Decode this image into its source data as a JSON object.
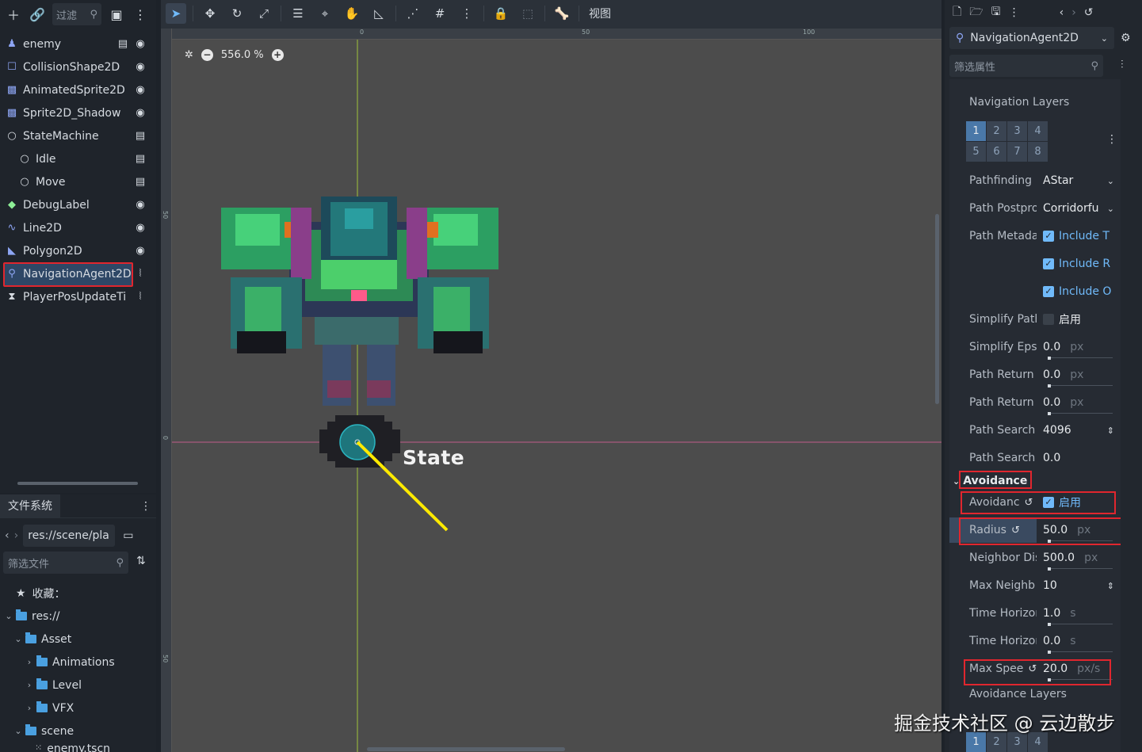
{
  "scene_panel": {
    "filter_placeholder": "过滤",
    "nodes": [
      {
        "name": "enemy",
        "icon": "character-body-icon",
        "right_icon": "script-icon",
        "second_icon": "visibility-icon"
      },
      {
        "name": "CollisionShape2D",
        "icon": "collision-shape-icon",
        "right_icon": "visibility-icon"
      },
      {
        "name": "AnimatedSprite2D",
        "icon": "animated-sprite-icon",
        "right_icon": "visibility-icon"
      },
      {
        "name": "Sprite2D_Shadow",
        "icon": "sprite-icon",
        "right_icon": "visibility-icon"
      },
      {
        "name": "StateMachine",
        "icon": "node-icon",
        "right_icon": "script-icon"
      },
      {
        "name": "Idle",
        "icon": "node-icon",
        "right_icon": "script-icon"
      },
      {
        "name": "Move",
        "icon": "node-icon",
        "right_icon": "script-icon"
      },
      {
        "name": "DebugLabel",
        "icon": "label-icon",
        "right_icon": "visibility-icon"
      },
      {
        "name": "Line2D",
        "icon": "line-icon",
        "right_icon": "visibility-icon"
      },
      {
        "name": "Polygon2D",
        "icon": "polygon-icon",
        "right_icon": "visibility-icon"
      },
      {
        "name": "NavigationAgent2D",
        "icon": "navigation-agent-icon",
        "right_icon": "signal-icon"
      },
      {
        "name": "PlayerPosUpdateTi",
        "icon": "timer-icon",
        "right_icon": "signal-icon"
      }
    ]
  },
  "filesystem": {
    "tab_label": "文件系统",
    "path": "res://scene/pla",
    "search_placeholder": "筛选文件",
    "items": [
      {
        "label": "收藏：",
        "type": "favorites"
      },
      {
        "label": "res://",
        "type": "root"
      },
      {
        "label": "Asset",
        "type": "folder"
      },
      {
        "label": "Animations",
        "type": "folder"
      },
      {
        "label": "Level",
        "type": "folder"
      },
      {
        "label": "VFX",
        "type": "folder"
      },
      {
        "label": "scene",
        "type": "folder"
      },
      {
        "label": "enemy.tscn",
        "type": "file"
      }
    ]
  },
  "viewport": {
    "view_menu": "视图",
    "zoom": "556.0 %",
    "ruler_top": [
      "0",
      "50",
      "100"
    ],
    "ruler_left": [
      "50",
      "0",
      "50"
    ],
    "debug_label": "State"
  },
  "inspector": {
    "node_name": "NavigationAgent2D",
    "filter_placeholder": "筛选属性",
    "nav_layers_label": "Navigation Layers",
    "layers": [
      "1",
      "2",
      "3",
      "4",
      "5",
      "6",
      "7",
      "8"
    ],
    "props": {
      "pathfinding": {
        "name": "Pathfinding",
        "value": "AStar"
      },
      "path_postpro": {
        "name": "Path Postpro",
        "value": "Corridorfu"
      },
      "path_metada": {
        "name": "Path Metada",
        "value": "Include T"
      },
      "include_r": {
        "value": "Include R"
      },
      "include_o": {
        "value": "Include O"
      },
      "simplify_path": {
        "name": "Simplify Path",
        "value": "启用"
      },
      "simplify_epsil": {
        "name": "Simplify Epsil",
        "value": "0.0",
        "unit": "px"
      },
      "path_return1": {
        "name": "Path Return",
        "value": "0.0",
        "unit": "px"
      },
      "path_return2": {
        "name": "Path Return",
        "value": "0.0",
        "unit": "px"
      },
      "path_search1": {
        "name": "Path Search",
        "value": "4096"
      },
      "path_search2": {
        "name": "Path Search",
        "value": "0.0"
      },
      "avoidance_section": "Avoidance",
      "avoidance": {
        "name": "Avoidanc",
        "value": "启用"
      },
      "radius": {
        "name": "Radius",
        "value": "50.0",
        "unit": "px"
      },
      "neighbor": {
        "name": "Neighbor Dis",
        "value": "500.0",
        "unit": "px"
      },
      "max_neigh": {
        "name": "Max Neighb",
        "value": "10"
      },
      "time_h1": {
        "name": "Time Horizon",
        "value": "1.0",
        "unit": "s"
      },
      "time_h2": {
        "name": "Time Horizon",
        "value": "0.0",
        "unit": "s"
      },
      "max_speed": {
        "name": "Max Spee",
        "value": "20.0",
        "unit": "px/s"
      },
      "avoid_layers": {
        "name": "Avoidance Layers"
      }
    }
  },
  "watermark": "掘金技术社区 @ 云边散步"
}
